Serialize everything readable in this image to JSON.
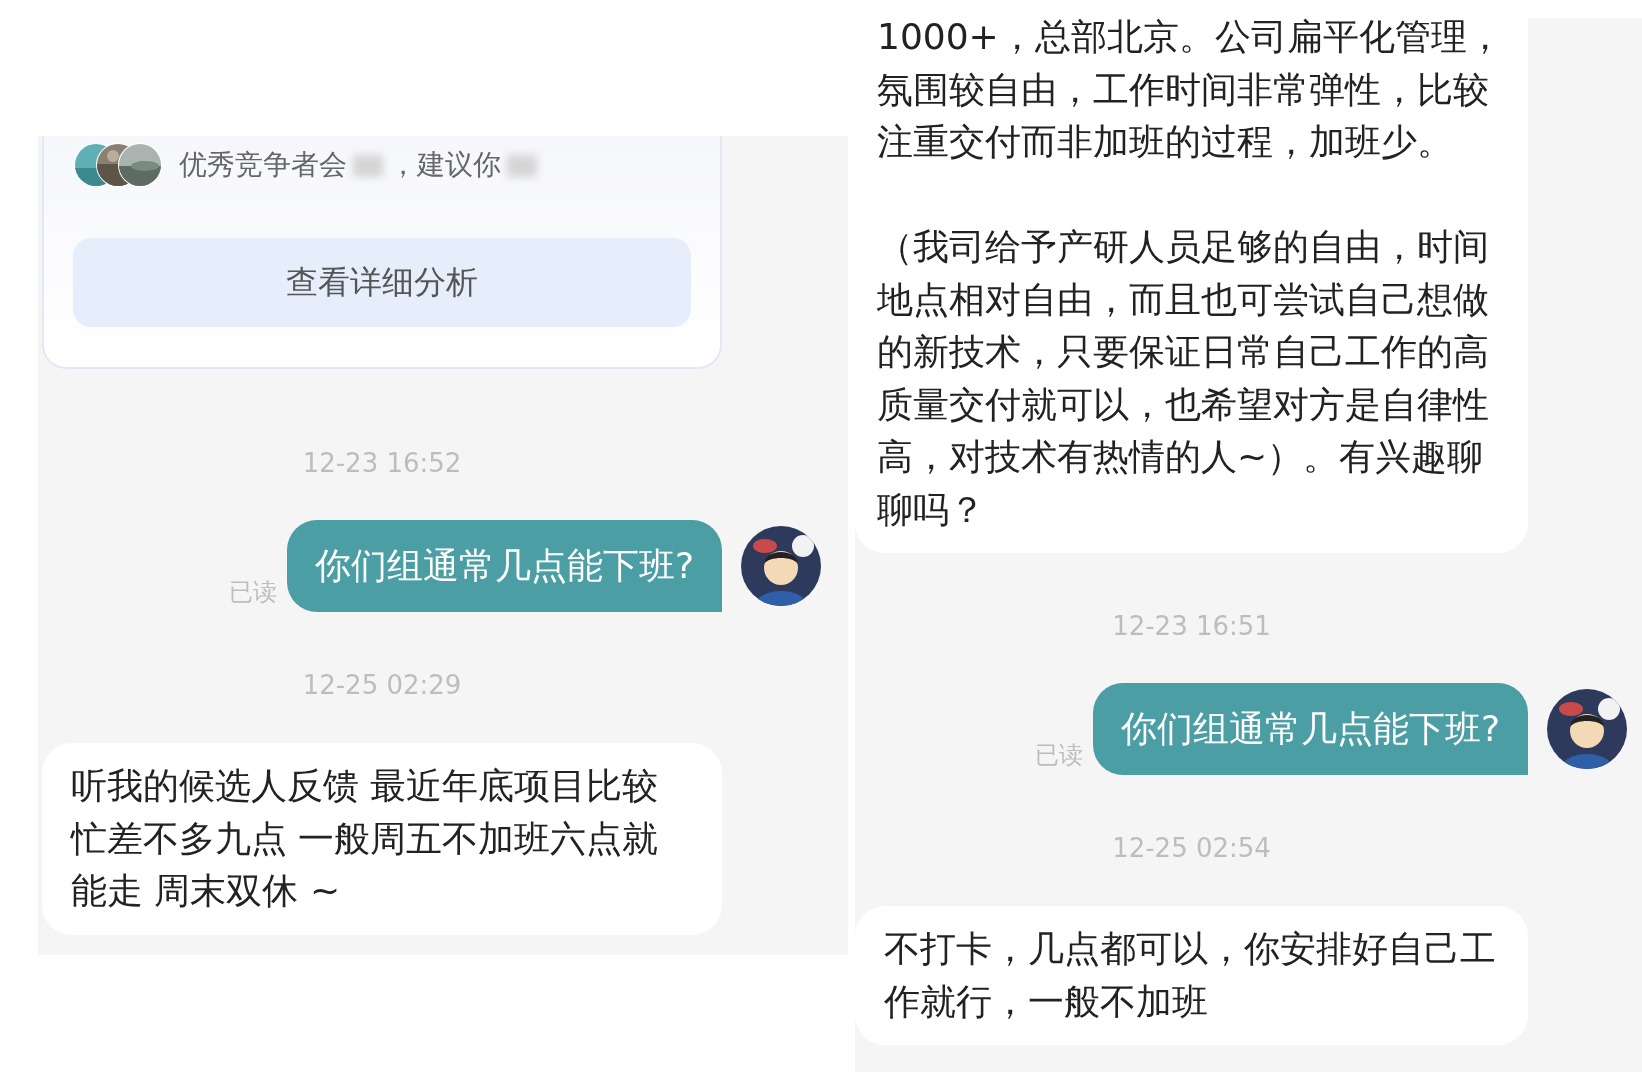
{
  "left_chat": {
    "card": {
      "summary_parts": [
        "优秀竞争者会",
        "，建议你"
      ],
      "button": "查看详细分析"
    },
    "messages": [
      {
        "kind": "time",
        "text": "12-23 16:52"
      },
      {
        "kind": "sent",
        "text": "你们组通常几点能下班?",
        "read_label": "已读"
      },
      {
        "kind": "time",
        "text": "12-25 02:29"
      },
      {
        "kind": "received",
        "text": [
          "听我的候选人反馈 最近年底项目比较忙差不多九点 一般周五不加班六点就能走 周末双休 ~"
        ]
      }
    ]
  },
  "right_chat": {
    "messages": [
      {
        "kind": "received",
        "cut_top": true,
        "text": [
          "1000+，总部北京。公司扁平化管理，氛围较自由，工作时间非常弹性，比较注重交付而非加班的过程，加班少。",
          "（我司给予产研人员足够的自由，时间地点相对自由，而且也可尝试自己想做的新技术，只要保证日常自己工作的高质量交付就可以，也希望对方是自律性高，对技术有热情的人~）。有兴趣聊聊吗？"
        ]
      },
      {
        "kind": "time",
        "text": "12-23 16:51"
      },
      {
        "kind": "sent",
        "text": "你们组通常几点能下班?",
        "read_label": "已读"
      },
      {
        "kind": "time",
        "text": "12-25 02:54"
      },
      {
        "kind": "received",
        "text": [
          "不打卡，几点都可以，你安排好自己工作就行，一般不加班"
        ]
      }
    ]
  }
}
